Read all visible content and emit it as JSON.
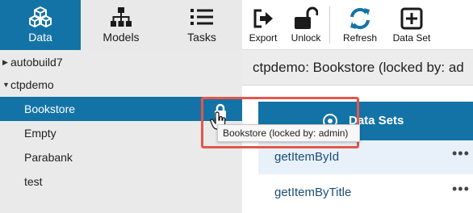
{
  "nav": {
    "tabs": [
      {
        "label": "Data",
        "icon": "cubes-icon",
        "active": true
      },
      {
        "label": "Models",
        "icon": "hierarchy-icon",
        "active": false
      },
      {
        "label": "Tasks",
        "icon": "list-icon",
        "active": false
      }
    ]
  },
  "toolbar": {
    "export_label": "Export",
    "unlock_label": "Unlock",
    "refresh_label": "Refresh",
    "dataset_label": "Data Set"
  },
  "sidebar": {
    "items": [
      {
        "label": "autobuild7",
        "type": "collapsed-folder"
      },
      {
        "label": "ctpdemo",
        "type": "expanded-folder"
      },
      {
        "label": "Bookstore",
        "type": "child",
        "selected": true,
        "locked": true
      },
      {
        "label": "Empty",
        "type": "child"
      },
      {
        "label": "Parabank",
        "type": "child"
      },
      {
        "label": "test",
        "type": "child"
      }
    ],
    "tooltip": "Bookstore (locked by: admin)"
  },
  "main": {
    "title": "ctpdemo: Bookstore (locked by: ad",
    "datasets_header": "Data Sets",
    "rows": [
      {
        "name": "getItemById",
        "menu": "•••"
      },
      {
        "name": "getItemByTitle",
        "menu": "•••"
      }
    ]
  },
  "colors": {
    "accent": "#1373a6",
    "highlight": "#e4564a",
    "sidebar_bg": "#eaeaea",
    "row_alt": "#e8f1f9"
  }
}
